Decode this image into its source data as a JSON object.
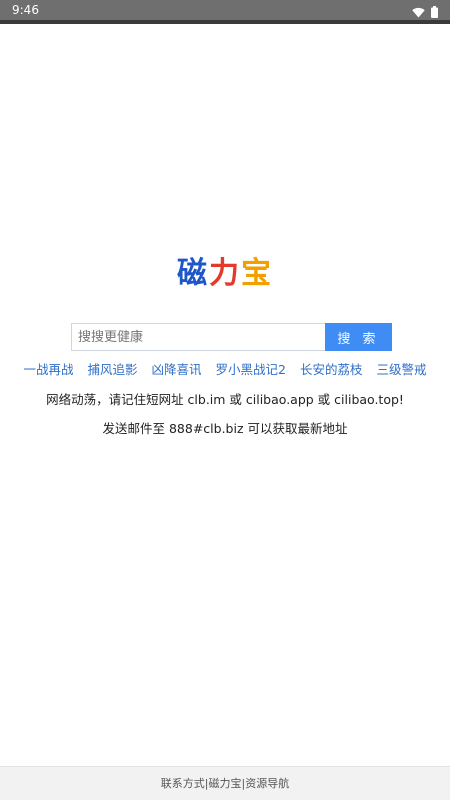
{
  "status_bar": {
    "time": "9:46",
    "icons": [
      "wifi-icon",
      "battery-icon"
    ]
  },
  "logo": {
    "part1": "磁",
    "part2": "力",
    "part3": "宝"
  },
  "search": {
    "placeholder": "搜搜更健康",
    "button_label": "搜 索"
  },
  "hot_links": [
    "一战再战",
    "捕风追影",
    "凶降喜讯",
    "罗小黑战记2",
    "长安的荔枝",
    "三级警戒"
  ],
  "notices": {
    "line1": "网络动荡，请记住短网址 clb.im 或 cilibao.app 或 cilibao.top!",
    "line2": "发送邮件至 888#clb.biz 可以获取最新地址"
  },
  "footer": {
    "contact": "联系方式",
    "brand": "磁力宝",
    "nav": "资源导航",
    "sep": "|"
  },
  "colors": {
    "accent": "#3f8cf5",
    "link": "#2f6fc8",
    "logo_blue": "#1f57c7",
    "logo_red": "#e23b2d",
    "logo_orange": "#f2a000"
  }
}
